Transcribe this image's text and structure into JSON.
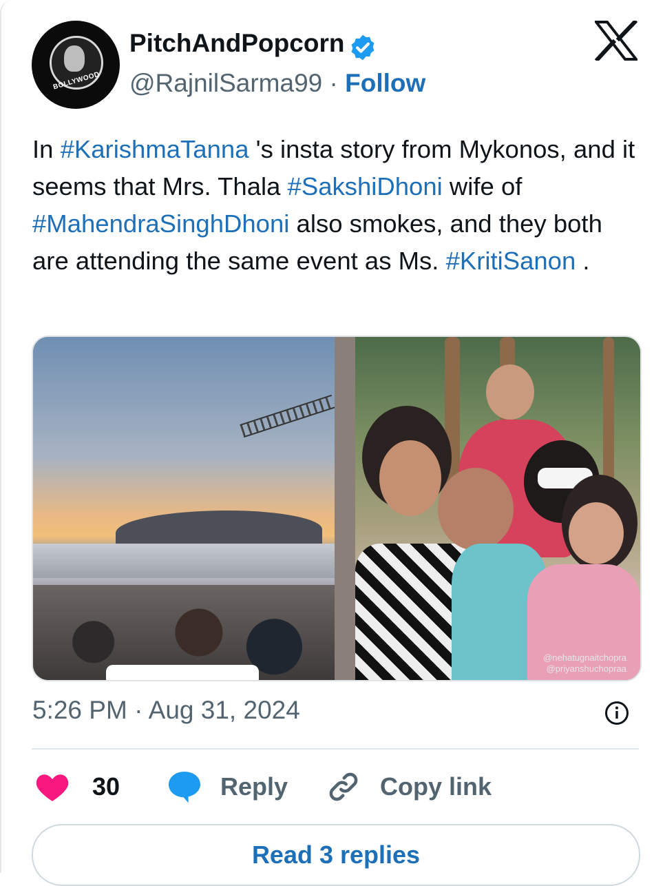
{
  "author": {
    "name": "PitchAndPopcorn",
    "handle": "@RajnilSarma99",
    "separator": "·",
    "follow_label": "Follow",
    "avatar_text": "BOLLYWOOD"
  },
  "tweet": {
    "segments": [
      {
        "text": "In ",
        "type": "text"
      },
      {
        "text": "#KarishmaTanna",
        "type": "hashtag"
      },
      {
        "text": " 's insta story from Mykonos, and it seems that Mrs. Thala ",
        "type": "text"
      },
      {
        "text": "#SakshiDhoni",
        "type": "hashtag"
      },
      {
        "text": " wife of ",
        "type": "text"
      },
      {
        "text": "#MahendraSinghDhoni",
        "type": "hashtag"
      },
      {
        "text": " also smokes, and they both are attending the same event as Ms. ",
        "type": "text"
      },
      {
        "text": "#KritiSanon",
        "type": "hashtag"
      },
      {
        "text": " .",
        "type": "text"
      }
    ]
  },
  "media": {
    "watermark_line1": "@nehatugnaitchopra",
    "watermark_line2": "@priyanshuchopraa"
  },
  "timestamp": {
    "time": "5:26 PM",
    "separator": "·",
    "date": "Aug 31, 2024"
  },
  "actions": {
    "like_count": "30",
    "reply_label": "Reply",
    "copy_link_label": "Copy link"
  },
  "read_replies_label": "Read 3 replies",
  "colors": {
    "link_blue": "#1d6fb8",
    "verified_blue": "#1d9bf0",
    "heart_pink": "#f91880",
    "secondary_text": "#536471"
  },
  "icons": [
    "verified-badge-icon",
    "x-logo-icon",
    "info-icon",
    "heart-icon",
    "reply-bubble-icon",
    "link-icon"
  ]
}
